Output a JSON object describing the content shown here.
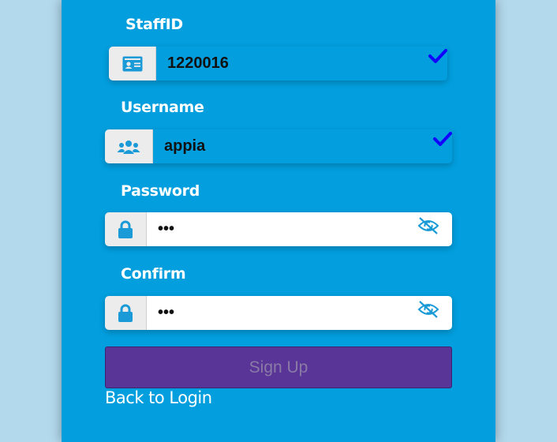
{
  "form": {
    "staff_id": {
      "label": "StaffID",
      "value": "1220016",
      "icon": "id-card-icon",
      "valid": true
    },
    "username": {
      "label": "Username",
      "value": "appia",
      "icon": "users-icon",
      "valid": true
    },
    "password": {
      "label": "Password",
      "value": "•••",
      "icon": "lock-icon",
      "toggle_icon": "eye-slash-icon"
    },
    "confirm": {
      "label": "Confirm",
      "value": "•••",
      "icon": "lock-icon",
      "toggle_icon": "eye-slash-icon"
    },
    "submit_label": "Sign Up",
    "back_link": "Back to Login"
  },
  "colors": {
    "page_background": "#b3d9ec",
    "panel": "#029ede",
    "accent_icon": "#1a9ad6",
    "check": "#1200ff",
    "button": "#5a3598",
    "button_text": "#8a7aa6"
  }
}
